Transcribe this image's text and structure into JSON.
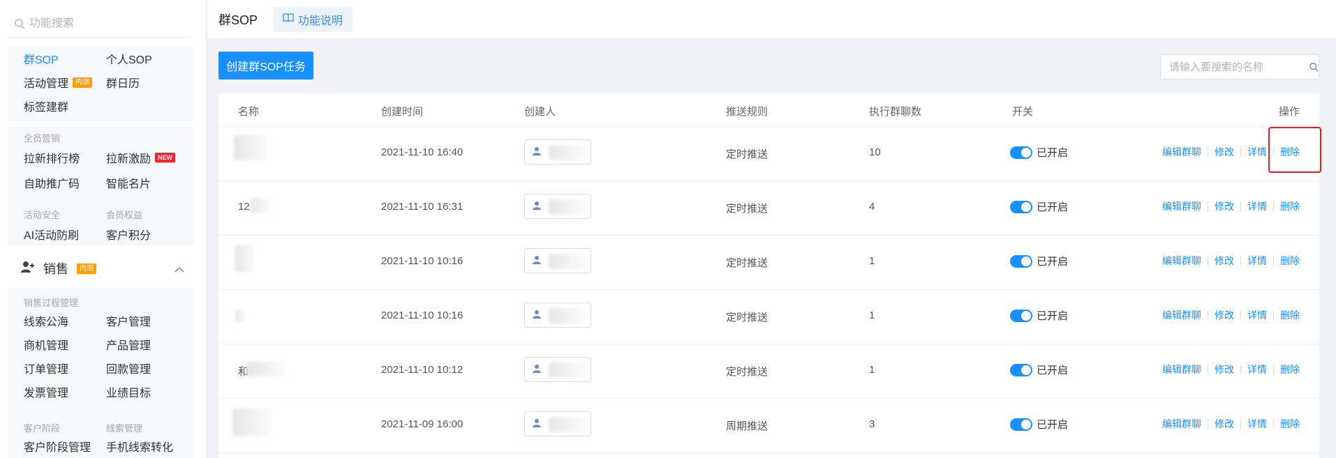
{
  "sidebar": {
    "search_placeholder": "功能搜索",
    "top_items": [
      "群SOP",
      "个人SOP",
      "活动管理",
      "群日历",
      "标签建群"
    ],
    "inner_tag": "内测",
    "new_tag": "NEW",
    "marketing_title": "全员营销",
    "marketing_items": [
      "拉新排行榜",
      "拉新激励",
      "自助推广码",
      "智能名片"
    ],
    "security_title": "活动安全",
    "member_title": "会员权益",
    "security_item": "AI活动防刷",
    "member_item": "客户积分",
    "sales_title": "销售",
    "sales_process_title": "销售过程管理",
    "sales_items": [
      "线索公海",
      "客户管理",
      "商机管理",
      "产品管理",
      "订单管理",
      "回款管理",
      "发票管理",
      "业绩目标"
    ],
    "stage_title": "客户阶段",
    "lead_title": "线索管理",
    "stage_item": "客户阶段管理",
    "lead_item": "手机线索转化"
  },
  "topbar": {
    "title": "群SOP",
    "help_label": "功能说明"
  },
  "toolbar": {
    "create_label": "创建群SOP任务",
    "search_placeholder": "请输入要搜索的名称"
  },
  "table": {
    "headers": [
      "名称",
      "创建时间",
      "创建人",
      "推送规则",
      "执行群聊数",
      "开关",
      "操作"
    ],
    "rows": [
      {
        "name": "",
        "time": "2021-11-10 16:40",
        "rule": "定时推送",
        "count": "10",
        "status": "已开启"
      },
      {
        "name": "12",
        "time": "2021-11-10 16:31",
        "rule": "定时推送",
        "count": "4",
        "status": "已开启"
      },
      {
        "name": "",
        "time": "2021-11-10 10:16",
        "rule": "定时推送",
        "count": "1",
        "status": "已开启"
      },
      {
        "name": "",
        "time": "2021-11-10 10:16",
        "rule": "定时推送",
        "count": "1",
        "status": "已开启"
      },
      {
        "name": "和",
        "time": "2021-11-10 10:12",
        "rule": "定时推送",
        "count": "1",
        "status": "已开启"
      },
      {
        "name": "",
        "time": "2021-11-09 16:00",
        "rule": "周期推送",
        "count": "3",
        "status": "已开启"
      }
    ],
    "actions": [
      "编辑群聊",
      "修改",
      "详情",
      "删除"
    ]
  },
  "colors": {
    "accent": "#1890ff",
    "highlight": "#e02020"
  }
}
